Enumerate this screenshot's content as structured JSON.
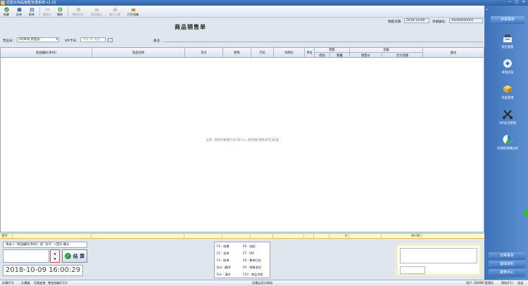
{
  "window": {
    "title": "迅雷云商品销售管理系统 v2.25",
    "controls": [
      "─",
      "□",
      "✕"
    ]
  },
  "toolbar": {
    "items": [
      {
        "label": "结算",
        "icon": "checkout-icon",
        "enabled": true
      },
      {
        "label": "挂单",
        "icon": "hold-order-icon",
        "enabled": true
      },
      {
        "label": "取单",
        "icon": "retrieve-order-icon",
        "enabled": true
      },
      {
        "label": "删除行",
        "icon": "delete-row-icon",
        "enabled": false
      },
      {
        "label": "撤单",
        "icon": "cancel-order-icon",
        "enabled": true
      },
      {
        "label": "整单打折",
        "icon": "discount-icon",
        "enabled": false
      },
      {
        "label": "添加赠品",
        "icon": "add-gift-icon",
        "enabled": false
      },
      {
        "label": "重打小票",
        "icon": "reprint-icon",
        "enabled": false
      },
      {
        "label": "打开钱箱",
        "icon": "cash-drawer-icon",
        "enabled": true
      }
    ]
  },
  "document": {
    "title": "商品销售单",
    "sale_date_label": "销售日期:",
    "sale_date": "2018-10-09",
    "doc_no_label": "单据编号:",
    "doc_no": "XS000000001",
    "salesperson_label": "营业员:",
    "salesperson": "ADMIN 管理员",
    "vip_label": "VIP卡号:",
    "vip_placeholder": "卡号 或 电话",
    "remark_label": "备注:",
    "remark": ""
  },
  "grid": {
    "columns": [
      "商品编码(条码)",
      "商品名称",
      "货号",
      "颜色",
      "尺码",
      "吊牌价",
      "单位",
      "销售",
      "金额",
      "备注"
    ],
    "sub_columns": {
      "销售": [
        "折扣",
        "数量"
      ],
      "金额": [
        "销售价",
        "合计金额"
      ]
    },
    "rows": [],
    "empty_message": "注意: 销售时数量为负(如-1)=系统做[销售退货]处理",
    "totals_label": "合计",
    "totals_qty": "0",
    "totals_amount": "¥0.00"
  },
  "entry": {
    "hint": "请录入 \"商品编码(条码)\" 或 \"货号\" +回车 确认",
    "code_value": "",
    "checkout_label": "结 算",
    "clock": "2018-10-09 16:00:29"
  },
  "shortcuts": [
    {
      "key": "F5",
      "action": "结算"
    },
    {
      "key": "F6",
      "action": "挂起"
    },
    {
      "key": "F2",
      "action": "挂单"
    },
    {
      "key": "F7",
      "action": "VIP"
    },
    {
      "key": "F3",
      "action": "取单"
    },
    {
      "key": "F8",
      "action": "整单打折"
    },
    {
      "key": "Del",
      "action": "删除"
    },
    {
      "key": "F9",
      "action": "销售退货"
    },
    {
      "key": "Esc",
      "action": "清空"
    },
    {
      "key": "F10",
      "action": "商品浏览"
    }
  ],
  "sidebar": {
    "header": "日常事务",
    "items": [
      {
        "label": "前台销售",
        "icon": "cash-register-icon"
      },
      {
        "label": "采购进货",
        "icon": "purchase-icon"
      },
      {
        "label": "商品管理",
        "icon": "goods-icon"
      },
      {
        "label": "VIP会员管理",
        "icon": "vip-member-icon"
      },
      {
        "label": "日销售明细分析",
        "icon": "analysis-icon"
      }
    ],
    "footer_items": [
      "日常事务",
      "基础资料",
      "报表中心"
    ]
  },
  "statusbar": {
    "items": [
      "折算(F4)",
      "计算器",
      "切换皮肤",
      "弹出钱箱(F12)"
    ],
    "center": "迅雷云官方网站",
    "user": "用户: ADMIN 管理员",
    "help": "帮助(F1)",
    "exit": "退出"
  },
  "colors": {
    "titlebar": "#2f63a8",
    "sidebar": "#4a7ec0",
    "totals_bg": "#fff9c9",
    "checkout_icon": "#2f9c3f"
  }
}
